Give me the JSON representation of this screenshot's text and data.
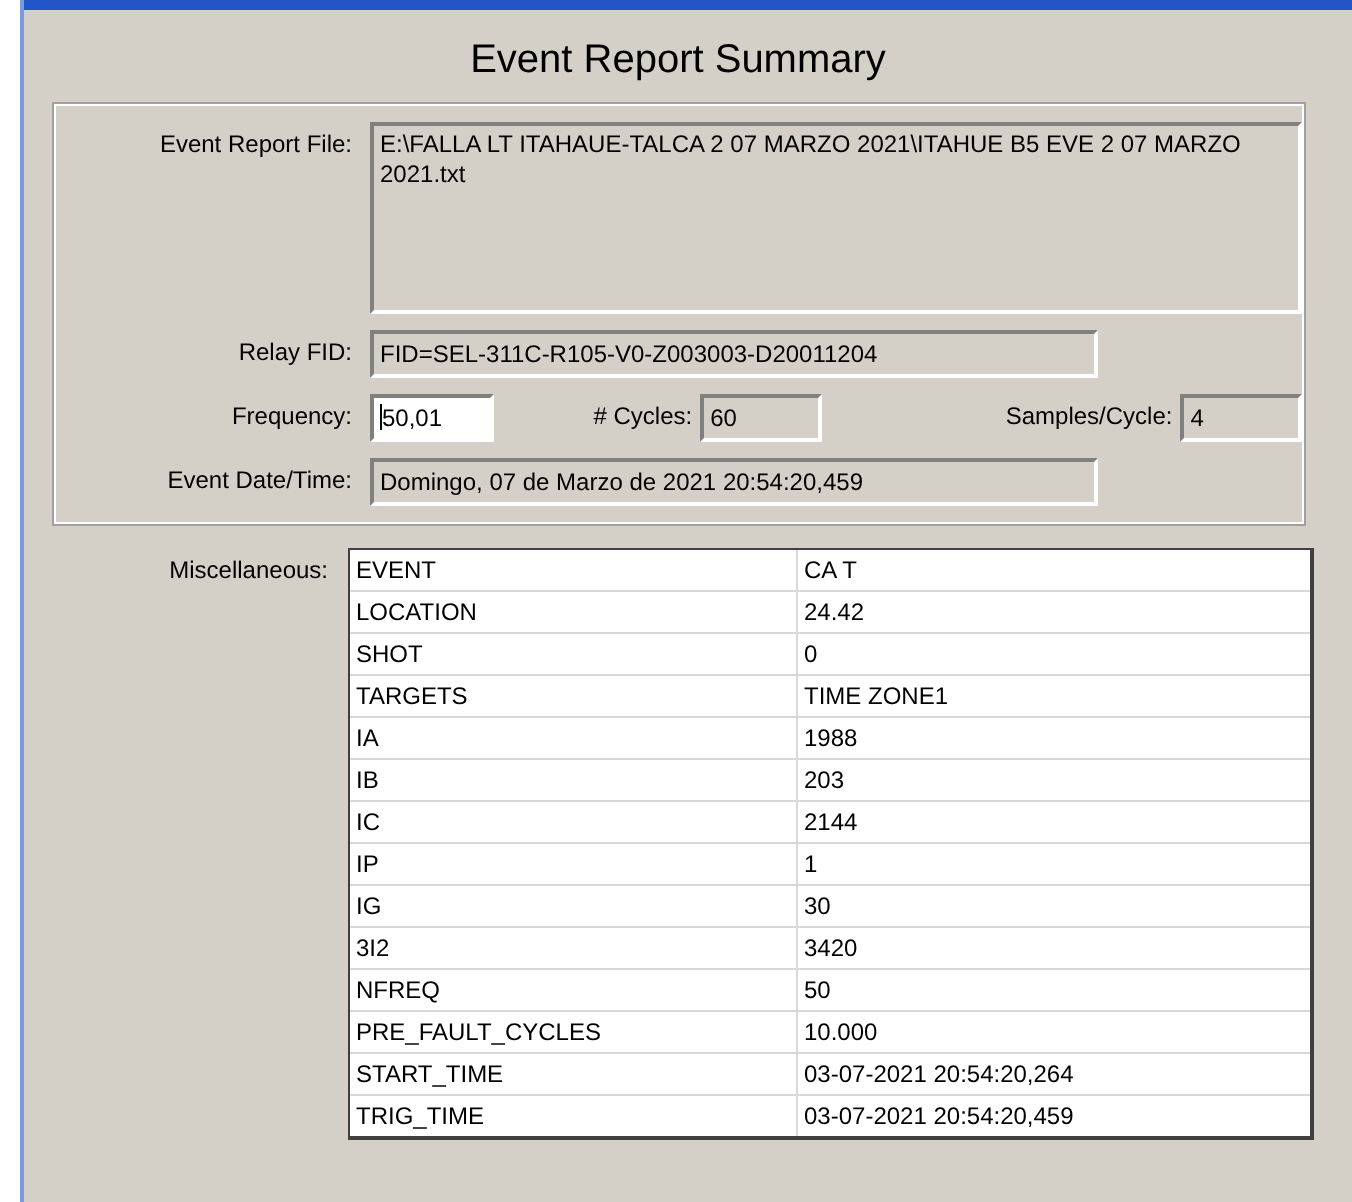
{
  "heading": "Event Report Summary",
  "event_report_file": {
    "label": "Event Report File:",
    "value": "E:\\FALLA LT ITAHAUE-TALCA 2 07 MARZO 2021\\ITAHUE B5 EVE 2 07 MARZO 2021.txt"
  },
  "relay_fid": {
    "label": "Relay FID:",
    "value": "FID=SEL-311C-R105-V0-Z003003-D20011204"
  },
  "frequency": {
    "label": "Frequency:",
    "value": "50,01",
    "disabled": false
  },
  "cycles": {
    "label": "# Cycles:",
    "value": "60",
    "disabled": true
  },
  "samples_per_cycle": {
    "label": "Samples/Cycle:",
    "value": "4",
    "disabled": true
  },
  "event_date_time": {
    "label": "Event Date/Time:",
    "value": "Domingo, 07 de Marzo de 2021  20:54:20,459"
  },
  "miscellaneous": {
    "label": "Miscellaneous:",
    "rows": [
      [
        "EVENT",
        "CA T"
      ],
      [
        "LOCATION",
        "24.42"
      ],
      [
        "SHOT",
        "0"
      ],
      [
        "TARGETS",
        "TIME ZONE1"
      ],
      [
        "IA",
        "1988"
      ],
      [
        "IB",
        "203"
      ],
      [
        "IC",
        "2144"
      ],
      [
        "IP",
        "1"
      ],
      [
        "IG",
        "30"
      ],
      [
        "3I2",
        "3420"
      ],
      [
        "NFREQ",
        "50"
      ],
      [
        "PRE_FAULT_CYCLES",
        "10.000"
      ],
      [
        "START_TIME",
        "03-07-2021 20:54:20,264"
      ],
      [
        "TRIG_TIME",
        "03-07-2021 20:54:20,459"
      ]
    ]
  }
}
